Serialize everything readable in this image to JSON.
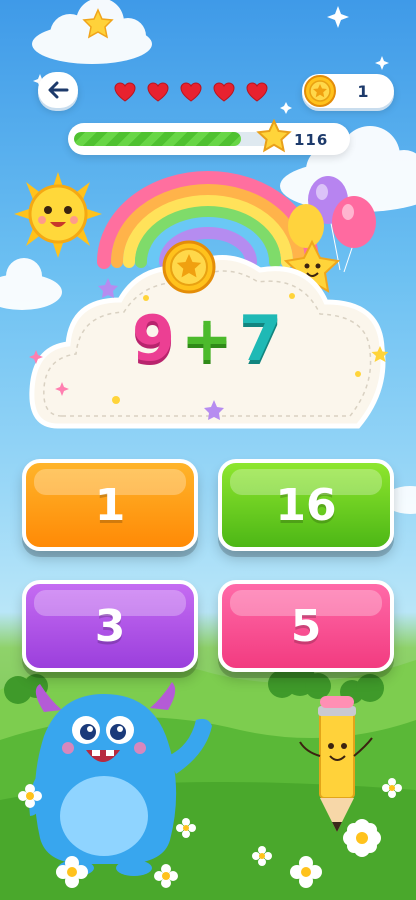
{
  "top_bar": {
    "back_icon": "arrow-left-icon",
    "hearts_count": 5,
    "heart_color": "#e8222f",
    "coins": "1"
  },
  "progress": {
    "fill_fraction": 0.85,
    "value": "116"
  },
  "question": {
    "operand1": "9",
    "operator": "+",
    "operand2": "7"
  },
  "answers": [
    {
      "label": "1",
      "color": "#ff9a12"
    },
    {
      "label": "16",
      "color": "#62c820"
    },
    {
      "label": "3",
      "color": "#ac52e6"
    },
    {
      "label": "5",
      "color": "#f84d8e"
    }
  ],
  "decor": {
    "sun": "sun-character",
    "rainbow": "rainbow",
    "balloons": "balloons",
    "star_character": "star-character",
    "monster": "blue-monster-character",
    "pencil": "pencil-character",
    "flowers": "daisy-flowers"
  }
}
